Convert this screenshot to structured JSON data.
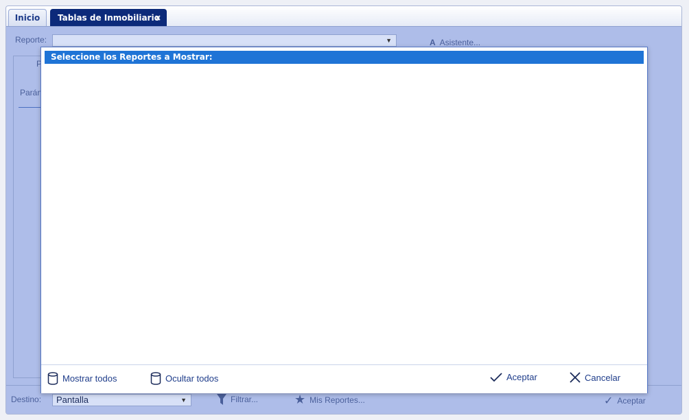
{
  "tabs": [
    {
      "label": "Inicio"
    },
    {
      "label": "Tablas de Inmobiliario",
      "close": "×"
    }
  ],
  "form": {
    "reporte_label": "Reporte:",
    "reporte_value": "",
    "asistente_label": "Asistente...",
    "panel_tab_label": "P",
    "parametros_label": "Parán"
  },
  "bottom": {
    "destino_label": "Destino:",
    "destino_value": "Pantalla",
    "filtrar_label": "Filtrar...",
    "mis_reportes_label": "Mis Reportes...",
    "aceptar_label": "Aceptar"
  },
  "modal": {
    "title": "Seleccione los Reportes a Mostrar:",
    "items": [],
    "mostrar_todos": "Mostrar todos",
    "ocultar_todos": "Ocultar todos",
    "aceptar": "Aceptar",
    "cancelar": "Cancelar"
  },
  "colors": {
    "accent": "#1f74d6",
    "active_tab": "#0c2a7a",
    "background": "#aebde9"
  }
}
